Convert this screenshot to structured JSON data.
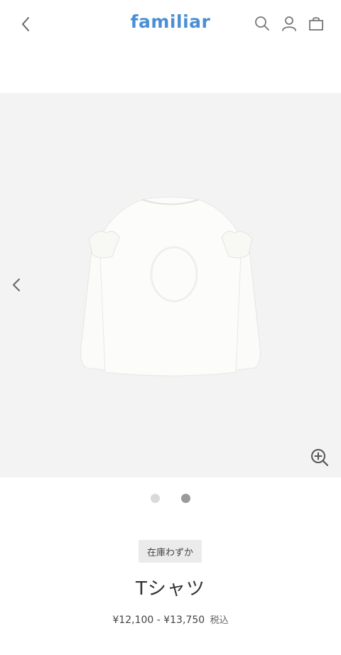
{
  "header": {
    "logo": "familiar",
    "brand_color": "#4a8fd6",
    "back_icon": "chevron-left-icon",
    "search_icon": "search-icon",
    "account_icon": "user-icon",
    "cart_icon": "shopping-bag-icon"
  },
  "gallery": {
    "background": "#f3f3f3",
    "current_slide": 2,
    "total_slides": 2,
    "prev_icon": "chevron-left-icon",
    "zoom_icon": "zoom-in-icon"
  },
  "product": {
    "stock_label": "在庫わずか",
    "name": "Tシャツ",
    "price_range": "¥12,100 - ¥13,750",
    "tax_label": "税込"
  }
}
